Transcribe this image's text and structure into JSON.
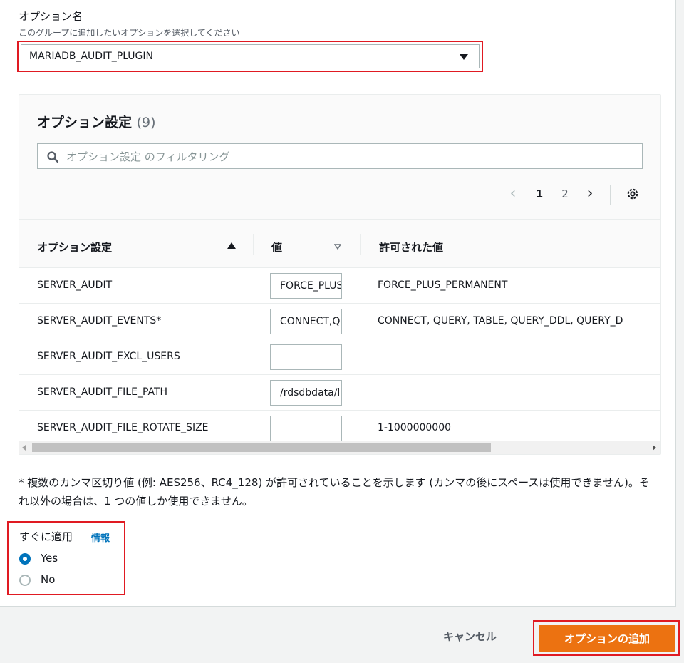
{
  "option_name": {
    "label": "オプション名",
    "description": "このグループに追加したいオプションを選択してください",
    "selected": "MARIADB_AUDIT_PLUGIN"
  },
  "settings": {
    "title": "オプション設定",
    "count": "(9)",
    "filter_placeholder": "オプション設定 のフィルタリング",
    "pagination": {
      "current": "1",
      "next_page": "2"
    },
    "columns": {
      "name": "オプション設定",
      "value": "値",
      "allowed": "許可された値"
    },
    "rows": [
      {
        "name": "SERVER_AUDIT",
        "value": "FORCE_PLUS_PERMANENT",
        "allowed": "FORCE_PLUS_PERMANENT"
      },
      {
        "name": "SERVER_AUDIT_EVENTS*",
        "value": "CONNECT,QUERY,TABLE",
        "allowed": "CONNECT, QUERY, TABLE, QUERY_DDL, QUERY_D"
      },
      {
        "name": "SERVER_AUDIT_EXCL_USERS",
        "value": "",
        "allowed": ""
      },
      {
        "name": "SERVER_AUDIT_FILE_PATH",
        "value": "/rdsdbdata/log/audit/",
        "allowed": ""
      },
      {
        "name": "SERVER_AUDIT_FILE_ROTATE_SIZE",
        "value": "",
        "allowed": "1-1000000000"
      }
    ]
  },
  "note": "* 複数のカンマ区切り値 (例: AES256、RC4_128) が許可されていることを示します (カンマの後にスペースは使用できません)。それ以外の場合は、1 つの値しか使用できません。",
  "apply_immediately": {
    "label": "すぐに適用",
    "info": "情報",
    "options": [
      "Yes",
      "No"
    ],
    "selected": "Yes"
  },
  "buttons": {
    "cancel": "キャンセル",
    "add": "オプションの追加"
  },
  "colors": {
    "primary": "#ec7211",
    "link": "#0073bb",
    "highlight": "#e01a22"
  }
}
